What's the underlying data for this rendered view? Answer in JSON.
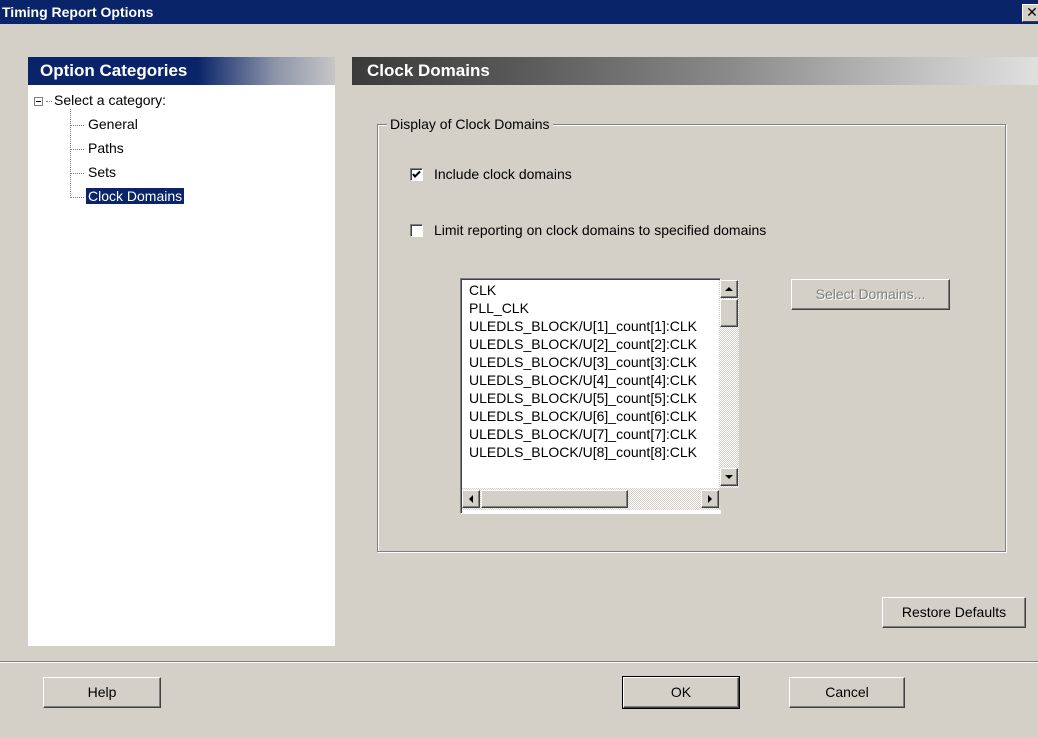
{
  "window": {
    "title": "Timing Report Options",
    "close_glyph": "✕"
  },
  "categories": {
    "header": "Option Categories",
    "root_label": "Select a category:",
    "items": [
      {
        "label": "General"
      },
      {
        "label": "Paths"
      },
      {
        "label": "Sets"
      },
      {
        "label": "Clock Domains",
        "selected": true
      }
    ]
  },
  "page": {
    "header": "Clock Domains",
    "group_label": "Display of Clock Domains",
    "include_clock_domains": {
      "label": "Include clock domains",
      "checked": true
    },
    "limit_reporting": {
      "label": "Limit reporting on clock domains to specified domains",
      "checked": false
    },
    "domains_list": [
      "CLK",
      "PLL_CLK",
      "ULEDLS_BLOCK/U[1]_count[1]:CLK",
      "ULEDLS_BLOCK/U[2]_count[2]:CLK",
      "ULEDLS_BLOCK/U[3]_count[3]:CLK",
      "ULEDLS_BLOCK/U[4]_count[4]:CLK",
      "ULEDLS_BLOCK/U[5]_count[5]:CLK",
      "ULEDLS_BLOCK/U[6]_count[6]:CLK",
      "ULEDLS_BLOCK/U[7]_count[7]:CLK",
      "ULEDLS_BLOCK/U[8]_count[8]:CLK"
    ],
    "select_domains_label": "Select Domains...",
    "restore_defaults_label": "Restore Defaults"
  },
  "footer": {
    "help_label": "Help",
    "ok_label": "OK",
    "cancel_label": "Cancel"
  },
  "colors": {
    "titlebar": "#0a246a",
    "dialog_bg": "#d4d0c8",
    "selection": "#0a246a"
  },
  "icons": {
    "check": "check-mark",
    "up": "up-arrow",
    "down": "down-arrow",
    "left": "left-arrow",
    "right": "right-arrow"
  }
}
